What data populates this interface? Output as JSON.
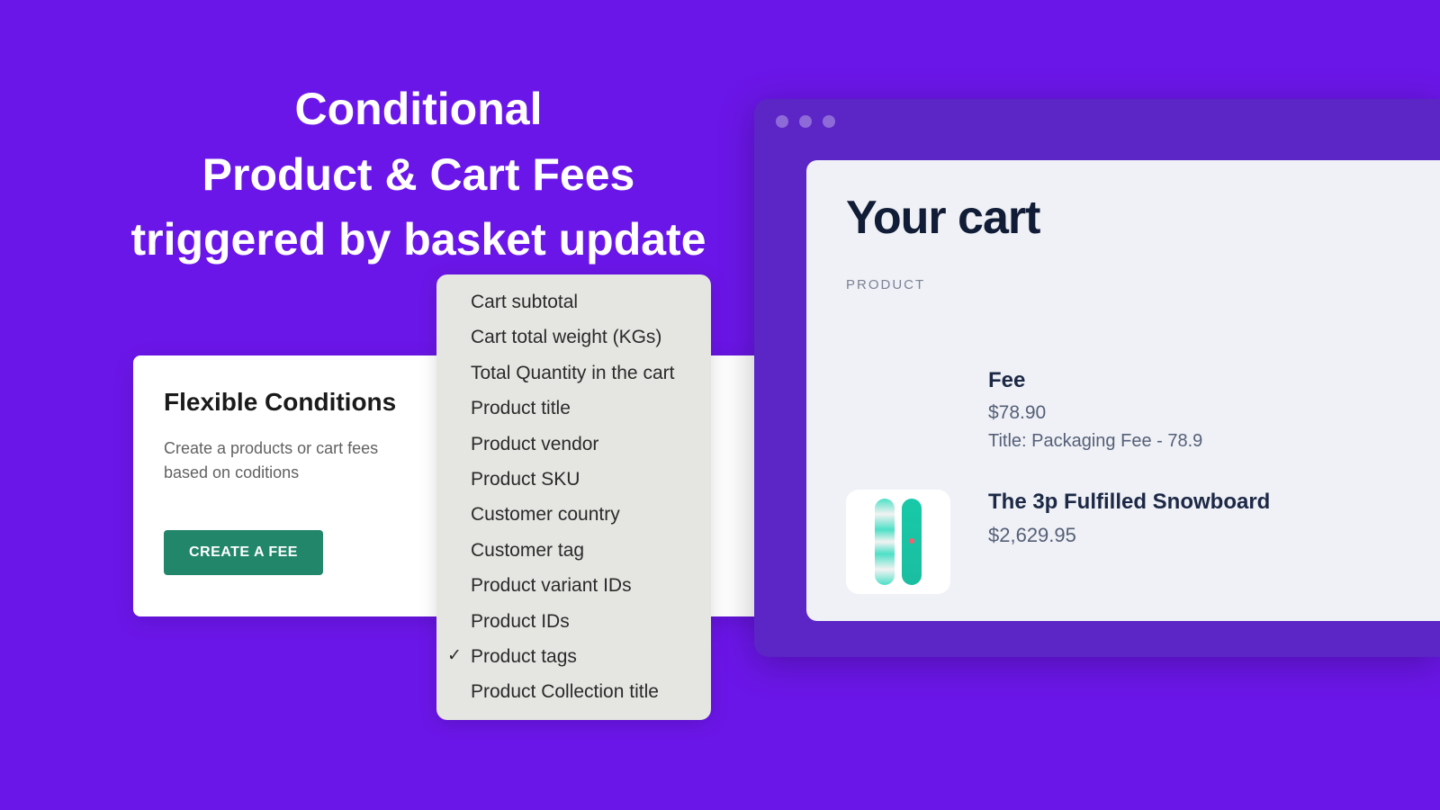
{
  "headline_line1": "Conditional",
  "headline_line2": "Product & Cart Fees",
  "headline_line3": "triggered by basket update",
  "left": {
    "title": "Flexible Conditions",
    "desc": "Create a products or cart fees based on coditions",
    "button": "CREATE A FEE"
  },
  "dropdown": {
    "items": [
      {
        "label": "Cart subtotal",
        "selected": false
      },
      {
        "label": "Cart total weight (KGs)",
        "selected": false
      },
      {
        "label": "Total Quantity in the cart",
        "selected": false
      },
      {
        "label": "Product title",
        "selected": false
      },
      {
        "label": "Product vendor",
        "selected": false
      },
      {
        "label": "Product SKU",
        "selected": false
      },
      {
        "label": "Customer country",
        "selected": false
      },
      {
        "label": "Customer tag",
        "selected": false
      },
      {
        "label": "Product variant IDs",
        "selected": false
      },
      {
        "label": "Product IDs",
        "selected": false
      },
      {
        "label": "Product tags",
        "selected": true
      },
      {
        "label": "Product Collection title",
        "selected": false
      }
    ]
  },
  "cart": {
    "heading": "Your cart",
    "column_label": "PRODUCT",
    "fee": {
      "title": "Fee",
      "price": "$78.90",
      "subtitle": "Title: Packaging Fee - 78.9"
    },
    "product": {
      "name": "The 3p Fulfilled Snowboard",
      "price": "$2,629.95"
    }
  }
}
